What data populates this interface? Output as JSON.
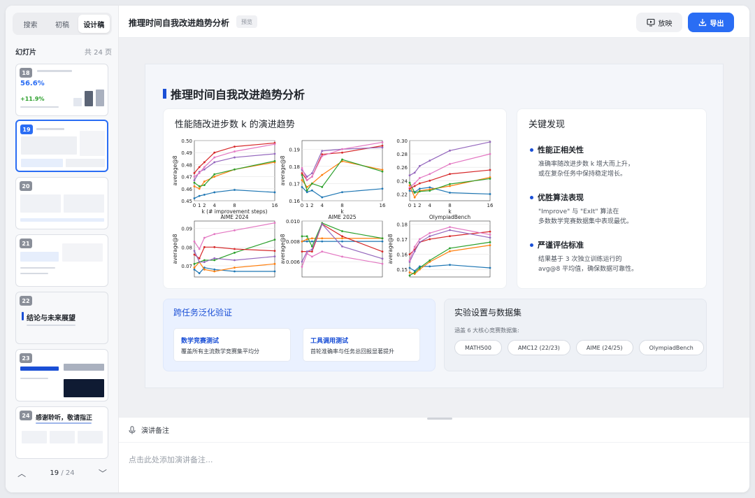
{
  "sidebar": {
    "tabs": [
      {
        "label": "搜索",
        "active": false
      },
      {
        "label": "初稿",
        "active": false
      },
      {
        "label": "设计稿",
        "active": true
      }
    ],
    "section_label": "幻灯片",
    "count_label": "共 24 页",
    "thumbnails": [
      {
        "num": "18",
        "big_text": "56.6%",
        "big_text2": "+11.9%"
      },
      {
        "num": "19",
        "active": true
      },
      {
        "num": "20"
      },
      {
        "num": "21"
      },
      {
        "num": "22",
        "big_text": "结论与未来展望"
      },
      {
        "num": "23"
      },
      {
        "num": "24",
        "big_text": "感谢聆听，敬请指正"
      }
    ],
    "pager": {
      "current": "19",
      "separator": "/",
      "total": "24"
    }
  },
  "topbar": {
    "title": "推理时间自我改进趋势分析",
    "tag": "预览",
    "play_label": "放映",
    "export_label": "导出"
  },
  "slide": {
    "title": "推理时间自我改进趋势分析",
    "chart_card_title": "性能随改进步数 k 的演进趋势",
    "findings_title": "关键发现",
    "findings": [
      {
        "title": "性能正相关性",
        "desc1": "准确率随改进步数 k 增大而上升，",
        "desc2": "或在复杂任务中保持稳定增长。"
      },
      {
        "title": "优胜算法表现",
        "desc1": "\"Improve\" 与 \"ExIt\" 算法在",
        "desc2": "多数数学竞赛数据集中表现最优。"
      },
      {
        "title": "严谨评估标准",
        "desc1": "结果基于 3 次独立训练运行的",
        "desc2": "avg@8 平均值，确保数据可靠性。"
      }
    ],
    "cross_title": "跨任务泛化验证",
    "cross_cards": [
      {
        "title": "数学竞赛测试",
        "desc": "覆盖所有主流数学竞赛集平均分"
      },
      {
        "title": "工具调用测试",
        "desc": "首轮准确率与任务总回报显著提升"
      }
    ],
    "setup_title": "实验设置与数据集",
    "setup_sub": "涵盖 6 大核心竞赛数据集:",
    "datasets": [
      "MATH500",
      "AMC12 (22/23)",
      "AIME (24/25)",
      "OlympiadBench"
    ]
  },
  "notes": {
    "label": "演讲备注",
    "placeholder": "点击此处添加演讲备注..."
  },
  "colors": {
    "accent": "#2a6df4",
    "series": [
      "#1f77b4",
      "#ff7f0e",
      "#2ca02c",
      "#d62728",
      "#9467bd",
      "#e377c2"
    ]
  },
  "chart_data": [
    {
      "type": "line",
      "title": "",
      "xlabel": "k (# improvement steps)",
      "ylabel": "average@8",
      "x": [
        0,
        1,
        2,
        4,
        8,
        16
      ],
      "xticks": [
        "0",
        "1",
        "2",
        "4",
        "8",
        "16"
      ],
      "ylim": [
        0.45,
        0.5
      ],
      "yticks": [
        "0.45",
        "0.46",
        "0.47",
        "0.48",
        "0.49",
        "0.50"
      ],
      "series": [
        {
          "values": [
            0.452,
            0.454,
            0.455,
            0.457,
            0.459,
            0.457
          ]
        },
        {
          "values": [
            0.462,
            0.46,
            0.466,
            0.47,
            0.476,
            0.482
          ]
        },
        {
          "values": [
            0.465,
            0.462,
            0.463,
            0.472,
            0.476,
            0.483
          ]
        },
        {
          "values": [
            0.473,
            0.478,
            0.482,
            0.49,
            0.495,
            0.498
          ]
        },
        {
          "values": [
            0.467,
            0.474,
            0.476,
            0.482,
            0.486,
            0.489
          ]
        },
        {
          "values": [
            0.47,
            0.473,
            0.478,
            0.486,
            0.491,
            0.497
          ]
        }
      ]
    },
    {
      "type": "line",
      "title": "",
      "xlabel": "k",
      "ylabel": "average@8",
      "x": [
        0,
        1,
        2,
        4,
        8,
        16
      ],
      "xticks": [
        "0",
        "1",
        "2",
        "4",
        "8",
        "16"
      ],
      "ylim": [
        0.16,
        0.195
      ],
      "yticks": [
        "0.16",
        "0.17",
        "0.18",
        "0.19"
      ],
      "series": [
        {
          "values": [
            0.168,
            0.165,
            0.166,
            0.162,
            0.165,
            0.167
          ]
        },
        {
          "values": [
            0.172,
            0.168,
            0.17,
            0.175,
            0.183,
            0.178
          ]
        },
        {
          "values": [
            0.175,
            0.166,
            0.17,
            0.168,
            0.184,
            0.177
          ]
        },
        {
          "values": [
            0.176,
            0.172,
            0.174,
            0.187,
            0.188,
            0.192
          ]
        },
        {
          "values": [
            0.178,
            0.174,
            0.176,
            0.189,
            0.19,
            0.191
          ]
        },
        {
          "values": [
            0.179,
            0.172,
            0.174,
            0.186,
            0.19,
            0.194
          ]
        }
      ]
    },
    {
      "type": "line",
      "title": "",
      "xlabel": "k",
      "ylabel": "",
      "x": [
        0,
        1,
        2,
        4,
        8,
        16
      ],
      "xticks": [
        "0",
        "1",
        "2",
        "4",
        "8",
        "16"
      ],
      "ylim": [
        0.21,
        0.3
      ],
      "yticks": [
        "0.22",
        "0.24",
        "0.26",
        "0.28",
        "0.30"
      ],
      "series": [
        {
          "values": [
            0.225,
            0.223,
            0.228,
            0.23,
            0.222,
            0.22
          ]
        },
        {
          "values": [
            0.233,
            0.215,
            0.225,
            0.227,
            0.232,
            0.245
          ]
        },
        {
          "values": [
            0.237,
            0.222,
            0.224,
            0.225,
            0.235,
            0.243
          ]
        },
        {
          "values": [
            0.228,
            0.232,
            0.236,
            0.24,
            0.25,
            0.256
          ]
        },
        {
          "values": [
            0.248,
            0.252,
            0.262,
            0.27,
            0.285,
            0.298
          ]
        },
        {
          "values": [
            0.23,
            0.236,
            0.244,
            0.25,
            0.265,
            0.28
          ]
        }
      ]
    },
    {
      "type": "line",
      "title": "AIME 2024",
      "xlabel": "",
      "ylabel": "average@8",
      "x": [
        0,
        1,
        2,
        4,
        8,
        16
      ],
      "ylim": [
        0.064,
        0.094
      ],
      "yticks": [
        "0.07",
        "0.08",
        "0.09"
      ],
      "series": [
        {
          "values": [
            0.068,
            0.066,
            0.069,
            0.068,
            0.067,
            0.067
          ]
        },
        {
          "values": [
            0.069,
            0.072,
            0.068,
            0.067,
            0.069,
            0.071
          ]
        },
        {
          "values": [
            0.071,
            0.072,
            0.073,
            0.073,
            0.077,
            0.084
          ]
        },
        {
          "values": [
            0.076,
            0.074,
            0.08,
            0.08,
            0.079,
            0.078
          ]
        },
        {
          "values": [
            0.078,
            0.072,
            0.072,
            0.074,
            0.073,
            0.075
          ]
        },
        {
          "values": [
            0.083,
            0.079,
            0.085,
            0.087,
            0.089,
            0.093
          ]
        }
      ]
    },
    {
      "type": "line",
      "title": "AIME 2025",
      "xlabel": "",
      "ylabel": "average@8",
      "x": [
        0,
        1,
        2,
        4,
        8,
        16
      ],
      "ylim": [
        0.0045,
        0.01
      ],
      "yticks": [
        "0.006",
        "0.008",
        "0.010"
      ],
      "series": [
        {
          "values": [
            0.008,
            0.008,
            0.008,
            0.008,
            0.008,
            0.008
          ]
        },
        {
          "values": [
            0.008,
            0.0082,
            0.0083,
            0.0083,
            0.0083,
            0.0083
          ]
        },
        {
          "values": [
            0.0085,
            0.0085,
            0.0075,
            0.0098,
            0.009,
            0.0083
          ]
        },
        {
          "values": [
            0.007,
            0.007,
            0.007,
            0.0097,
            0.0085,
            0.007
          ]
        },
        {
          "values": [
            0.006,
            0.007,
            0.0072,
            0.0097,
            0.0075,
            0.0063
          ]
        },
        {
          "values": [
            0.0055,
            0.0068,
            0.0065,
            0.007,
            0.0065,
            0.0058
          ]
        }
      ]
    },
    {
      "type": "line",
      "title": "OlympiadBench",
      "xlabel": "",
      "ylabel": "average@8",
      "x": [
        0,
        1,
        2,
        4,
        8,
        16
      ],
      "ylim": [
        0.145,
        0.182
      ],
      "yticks": [
        "0.15",
        "0.16",
        "0.17",
        "0.18"
      ],
      "series": [
        {
          "values": [
            0.151,
            0.149,
            0.152,
            0.152,
            0.153,
            0.151
          ]
        },
        {
          "values": [
            0.148,
            0.147,
            0.15,
            0.155,
            0.162,
            0.166
          ]
        },
        {
          "values": [
            0.146,
            0.148,
            0.151,
            0.156,
            0.164,
            0.168
          ]
        },
        {
          "values": [
            0.16,
            0.163,
            0.168,
            0.17,
            0.172,
            0.175
          ]
        },
        {
          "values": [
            0.155,
            0.162,
            0.168,
            0.172,
            0.176,
            0.171
          ]
        },
        {
          "values": [
            0.156,
            0.165,
            0.17,
            0.174,
            0.178,
            0.173
          ]
        }
      ]
    }
  ]
}
